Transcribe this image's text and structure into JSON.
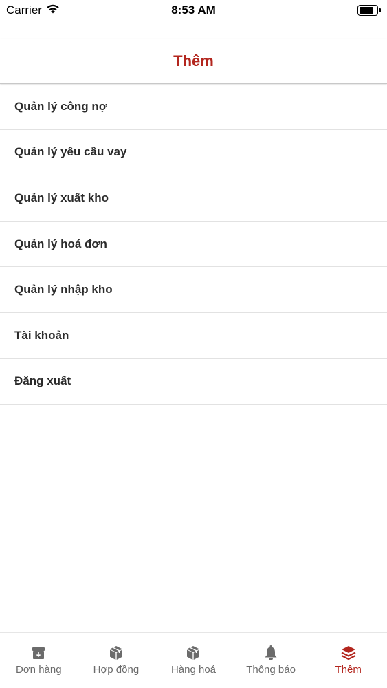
{
  "status_bar": {
    "carrier": "Carrier",
    "time": "8:53 AM",
    "battery_level": 0.85
  },
  "header": {
    "title": "Thêm"
  },
  "menu": {
    "items": [
      {
        "label": "Quản lý công nợ"
      },
      {
        "label": "Quản lý yêu cầu vay"
      },
      {
        "label": "Quản lý xuất kho"
      },
      {
        "label": "Quản lý hoá đơn"
      },
      {
        "label": "Quản lý nhập kho"
      },
      {
        "label": "Tài khoản"
      },
      {
        "label": "Đăng xuất"
      }
    ]
  },
  "tab_bar": {
    "active_index": 4,
    "tabs": [
      {
        "label": "Đơn hàng",
        "icon": "archive-box-icon"
      },
      {
        "label": "Hợp đồng",
        "icon": "cube-box-icon"
      },
      {
        "label": "Hàng hoá",
        "icon": "cube-box-icon"
      },
      {
        "label": "Thông báo",
        "icon": "bell-icon"
      },
      {
        "label": "Thêm",
        "icon": "layers-icon"
      }
    ]
  },
  "colors": {
    "accent": "#b3261e",
    "inactive": "#6b6b6b"
  }
}
